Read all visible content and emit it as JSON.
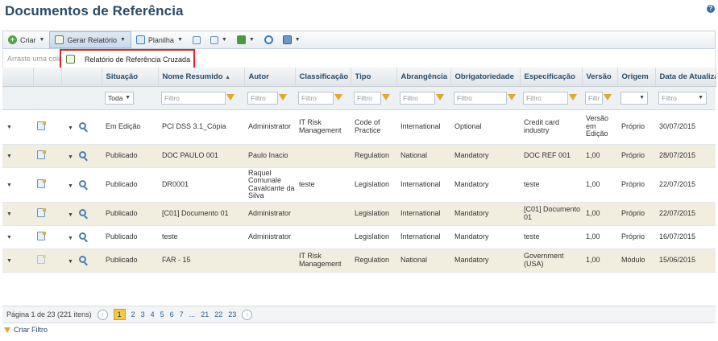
{
  "page": {
    "title": "Documentos de Referência",
    "help": "?"
  },
  "toolbar": {
    "create_label": "Criar",
    "report_label": "Gerar Relatório",
    "sheet_label": "Planilha"
  },
  "grouping": {
    "placeholder": "Arraste uma colu"
  },
  "menu": {
    "item_label": "Relatório de Referência Cruzada"
  },
  "table": {
    "headers": [
      "Situação",
      "Nome Resumido",
      "Autor",
      "Classificação",
      "Tipo",
      "Abrangência",
      "Obrigatoriedade",
      "Especificação",
      "Versão",
      "Origem",
      "Data de Atualização"
    ],
    "sort_indicator": "▲",
    "filter_placeholder": "Filtro",
    "situacao_select": "Todas",
    "rows": [
      {
        "situacao": "Em Edição",
        "nome": "PCI DSS 3.1_Cópia",
        "autor": "Administrator",
        "classificacao": "IT Risk Management",
        "tipo": "Code of Practice",
        "abrangencia": "International",
        "obrigatoriedade": "Optional",
        "especificacao": "Credit card industry",
        "versao": "Versão em Edição",
        "origem": "Próprio",
        "data": "30/07/2015"
      },
      {
        "situacao": "Publicado",
        "nome": "DOC PAULO 001",
        "autor": "Paulo Inacio",
        "classificacao": "",
        "tipo": "Regulation",
        "abrangencia": "National",
        "obrigatoriedade": "Mandatory",
        "especificacao": "DOC REF 001",
        "versao": "1,00",
        "origem": "Próprio",
        "data": "28/07/2015"
      },
      {
        "situacao": "Publicado",
        "nome": "DR0001",
        "autor": "Raquel Comunale Cavalcante da Silva",
        "classificacao": "teste",
        "tipo": "Legislation",
        "abrangencia": "International",
        "obrigatoriedade": "Mandatory",
        "especificacao": "teste",
        "versao": "1,00",
        "origem": "Próprio",
        "data": "22/07/2015"
      },
      {
        "situacao": "Publicado",
        "nome": "[C01] Documento 01",
        "autor": "Administrator",
        "classificacao": "",
        "tipo": "Legislation",
        "abrangencia": "International",
        "obrigatoriedade": "Mandatory",
        "especificacao": "[C01] Documento 01",
        "versao": "1,00",
        "origem": "Próprio",
        "data": "22/07/2015"
      },
      {
        "situacao": "Publicado",
        "nome": "teste",
        "autor": "Administrator",
        "classificacao": "",
        "tipo": "Legislation",
        "abrangencia": "International",
        "obrigatoriedade": "Mandatory",
        "especificacao": "teste",
        "versao": "1,00",
        "origem": "Próprio",
        "data": "16/07/2015"
      },
      {
        "situacao": "Publicado",
        "nome": "FAR - 15",
        "autor": "",
        "classificacao": "IT Risk Management",
        "tipo": "Regulation",
        "abrangencia": "National",
        "obrigatoriedade": "Mandatory",
        "especificacao": "Government (USA)",
        "versao": "1,00",
        "origem": "Módulo",
        "data": "15/06/2015"
      }
    ]
  },
  "pager": {
    "summary": "Página 1 de 23 (221 itens)",
    "prev": "‹",
    "pages": [
      "1",
      "2",
      "3",
      "4",
      "5",
      "6",
      "7",
      "...",
      "21",
      "22",
      "23"
    ],
    "next": "›"
  },
  "footer": {
    "create_filter": "Criar Filtro"
  }
}
